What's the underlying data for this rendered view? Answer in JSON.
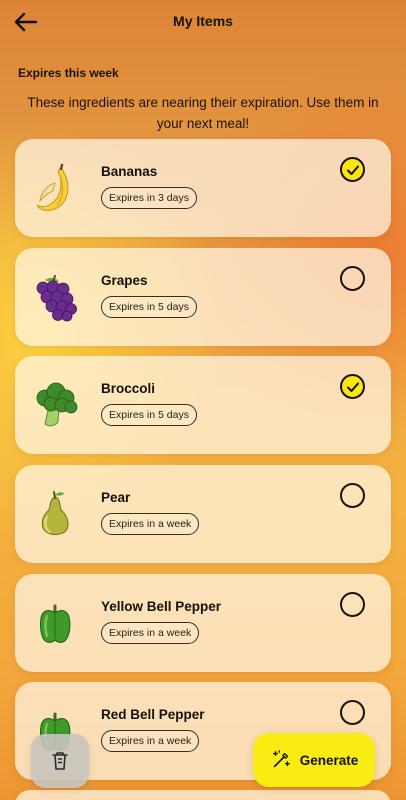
{
  "header": {
    "title": "My Items"
  },
  "section": {
    "title": "Expires this week",
    "description": "These ingredients are nearing their expiration. Use them in your next meal!"
  },
  "items": [
    {
      "name": "Bananas",
      "expiry": "Expires in 3 days",
      "icon": "banana-icon",
      "checked": true
    },
    {
      "name": "Grapes",
      "expiry": "Expires in 5 days",
      "icon": "grapes-icon",
      "checked": false
    },
    {
      "name": "Broccoli",
      "expiry": "Expires in 5 days",
      "icon": "broccoli-icon",
      "checked": true
    },
    {
      "name": "Pear",
      "expiry": "Expires in a week",
      "icon": "pear-icon",
      "checked": false
    },
    {
      "name": "Yellow Bell Pepper",
      "expiry": "Expires in a week",
      "icon": "bell-pepper-icon",
      "checked": false
    },
    {
      "name": "Red Bell Pepper",
      "expiry": "Expires in a week",
      "icon": "bell-pepper-icon",
      "checked": false
    }
  ],
  "actions": {
    "generate_label": "Generate"
  },
  "colors": {
    "accent": "#f9ec13",
    "check_fill": "#f8e60c"
  }
}
